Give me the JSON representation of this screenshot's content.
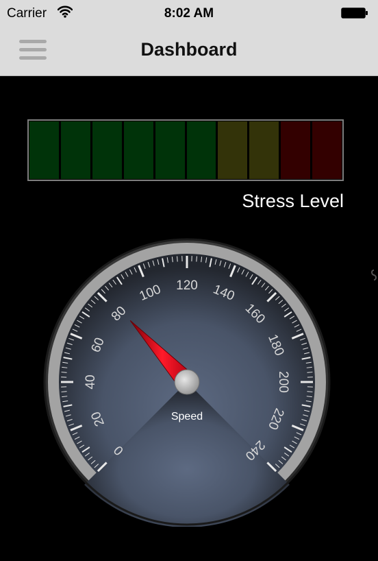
{
  "status_bar": {
    "carrier": "Carrier",
    "time": "8:02 AM",
    "wifi_icon": "wifi-icon",
    "battery_icon": "battery-icon"
  },
  "nav": {
    "title": "Dashboard",
    "menu_icon": "hamburger-menu-icon"
  },
  "stress": {
    "label": "Stress Level",
    "segments": [
      {
        "color": "#003309"
      },
      {
        "color": "#003309"
      },
      {
        "color": "#003309"
      },
      {
        "color": "#003309"
      },
      {
        "color": "#003309"
      },
      {
        "color": "#003309"
      },
      {
        "color": "#333309"
      },
      {
        "color": "#333309"
      },
      {
        "color": "#330000"
      },
      {
        "color": "#330000"
      }
    ]
  },
  "gauge": {
    "label": "Speed",
    "min": 0,
    "max": 240,
    "value": 82,
    "tick_labels": [
      "0",
      "20",
      "40",
      "60",
      "80",
      "100",
      "120",
      "140",
      "160",
      "180",
      "200",
      "220",
      "240"
    ],
    "needle_color": "#d90012"
  }
}
